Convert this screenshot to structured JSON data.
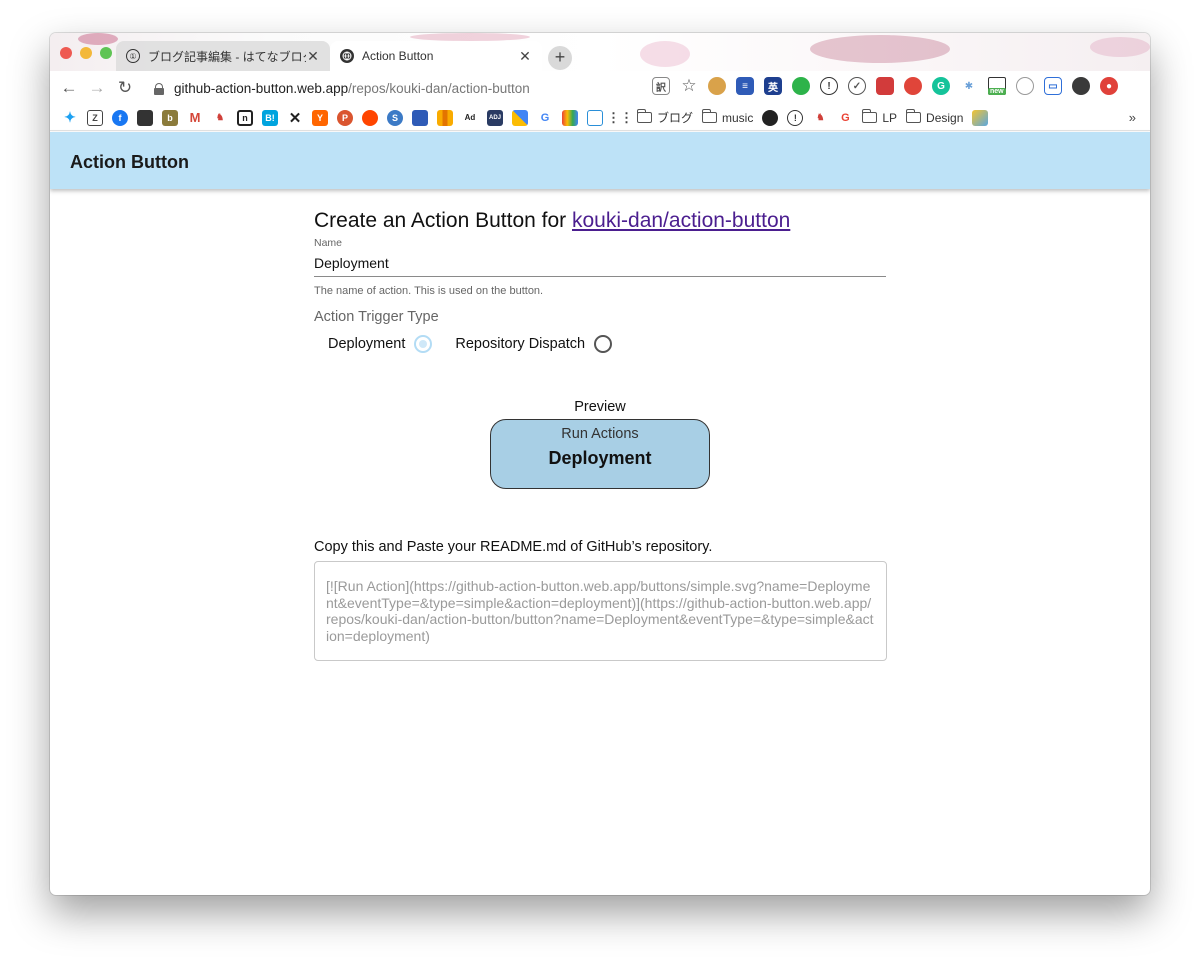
{
  "tabs": [
    {
      "title": "ブログ記事編集 - はてなブログ",
      "icon": "password-manager-icon",
      "active": false
    },
    {
      "title": "Action Button",
      "icon": "globe-icon",
      "active": true
    }
  ],
  "toolbar": {
    "url_host": "github-action-button.web.app",
    "url_path": "/repos/kouki-dan/action-button"
  },
  "extensions": [
    "translate-icon",
    "star-icon",
    "cookie-icon",
    "notes-icon",
    "dictionary-icon",
    "evernote-icon",
    "password-manager-icon",
    "pocket-icon",
    "extension-icon",
    "adblock-icon",
    "grammarly-icon",
    "twitter-icon",
    "screenshot-icon",
    "timer-icon",
    "tab-icon",
    "profile-icon",
    "record-icon"
  ],
  "extension_badge": "new",
  "bookmarks": {
    "icons": [
      "twitter-icon",
      "zenn-icon",
      "facebook-icon",
      "tv-icon",
      "hatena-icon",
      "gmail-icon",
      "unicorn-icon",
      "note-icon",
      "hatena-bookmark-icon",
      "x-icon",
      "ycombinator-icon",
      "producthunt-icon",
      "reddit-icon",
      "stackshare-icon",
      "news-icon",
      "analytics-icon",
      "adage-icon",
      "adobe-icon",
      "google-ads-icon",
      "google-icon",
      "rainbow-icon",
      "photo-icon",
      "apps-icon"
    ],
    "folder_blog": "ブログ",
    "folder_music": "music",
    "folder_lp": "LP",
    "folder_design": "Design",
    "more": "»"
  },
  "app": {
    "title": "Action Button",
    "heading_prefix": "Create an Action Button for ",
    "repo_link": "kouki-dan/action-button",
    "name_label": "Name",
    "name_value": "Deployment",
    "name_helper": "The name of action. This is used on the button.",
    "trigger_label": "Action Trigger Type",
    "trigger_options": [
      {
        "label": "Deployment",
        "checked": true
      },
      {
        "label": "Repository Dispatch",
        "checked": false
      }
    ],
    "preview_label": "Preview",
    "preview_small": "Run Actions",
    "preview_big": "Deployment",
    "copy_label": "Copy this and Paste your README.md of GitHub’s repository.",
    "copy_text": "[![Run Action](https://github-action-button.web.app/buttons/simple.svg?name=Deployment&eventType=&type=simple&action=deployment)](https://github-action-button.web.app/repos/kouki-dan/action-button/button?name=Deployment&eventType=&type=simple&action=deployment)"
  },
  "colors": {
    "appbar": "#bde2f7",
    "preview_button": "#a8cfe5",
    "link": "#4b1e8f"
  }
}
